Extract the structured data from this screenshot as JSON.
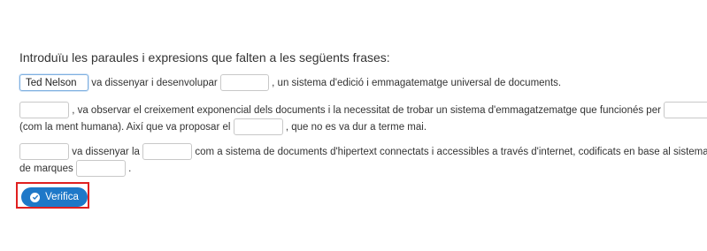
{
  "instructions": "Introduïu les paraules i expresions que falten a les següents frases:",
  "sentence1": {
    "gap1_value": "Ted Nelson",
    "text1": "va dissenyar i desenvolupar",
    "gap2_value": "",
    "text2": ", un sistema d'edició i emmagatematge universal de documents."
  },
  "sentence2": {
    "gap1_value": "",
    "text1": ", va observar el creixement exponencial dels documents i la necessitat de trobar un sistema d'emmagatzematge que funcionés per",
    "gap2_value": "",
    "text2": "(com la ment humana). Així que va proposar el",
    "gap3_value": "",
    "text3": ", que no es va dur a terme mai."
  },
  "sentence3": {
    "gap1_value": "",
    "text1": "va dissenyar la",
    "gap2_value": "",
    "text2": "com a sistema de documents d'hipertext connectats i accessibles a través d'internet, codificats en base al sistema",
    "text3": "de marques",
    "gap3_value": "",
    "text4": "."
  },
  "verify_button": {
    "label": "Verifica",
    "icon": "check-circle-icon"
  },
  "colors": {
    "button": "#1e78c8",
    "highlight": "#e02020"
  }
}
